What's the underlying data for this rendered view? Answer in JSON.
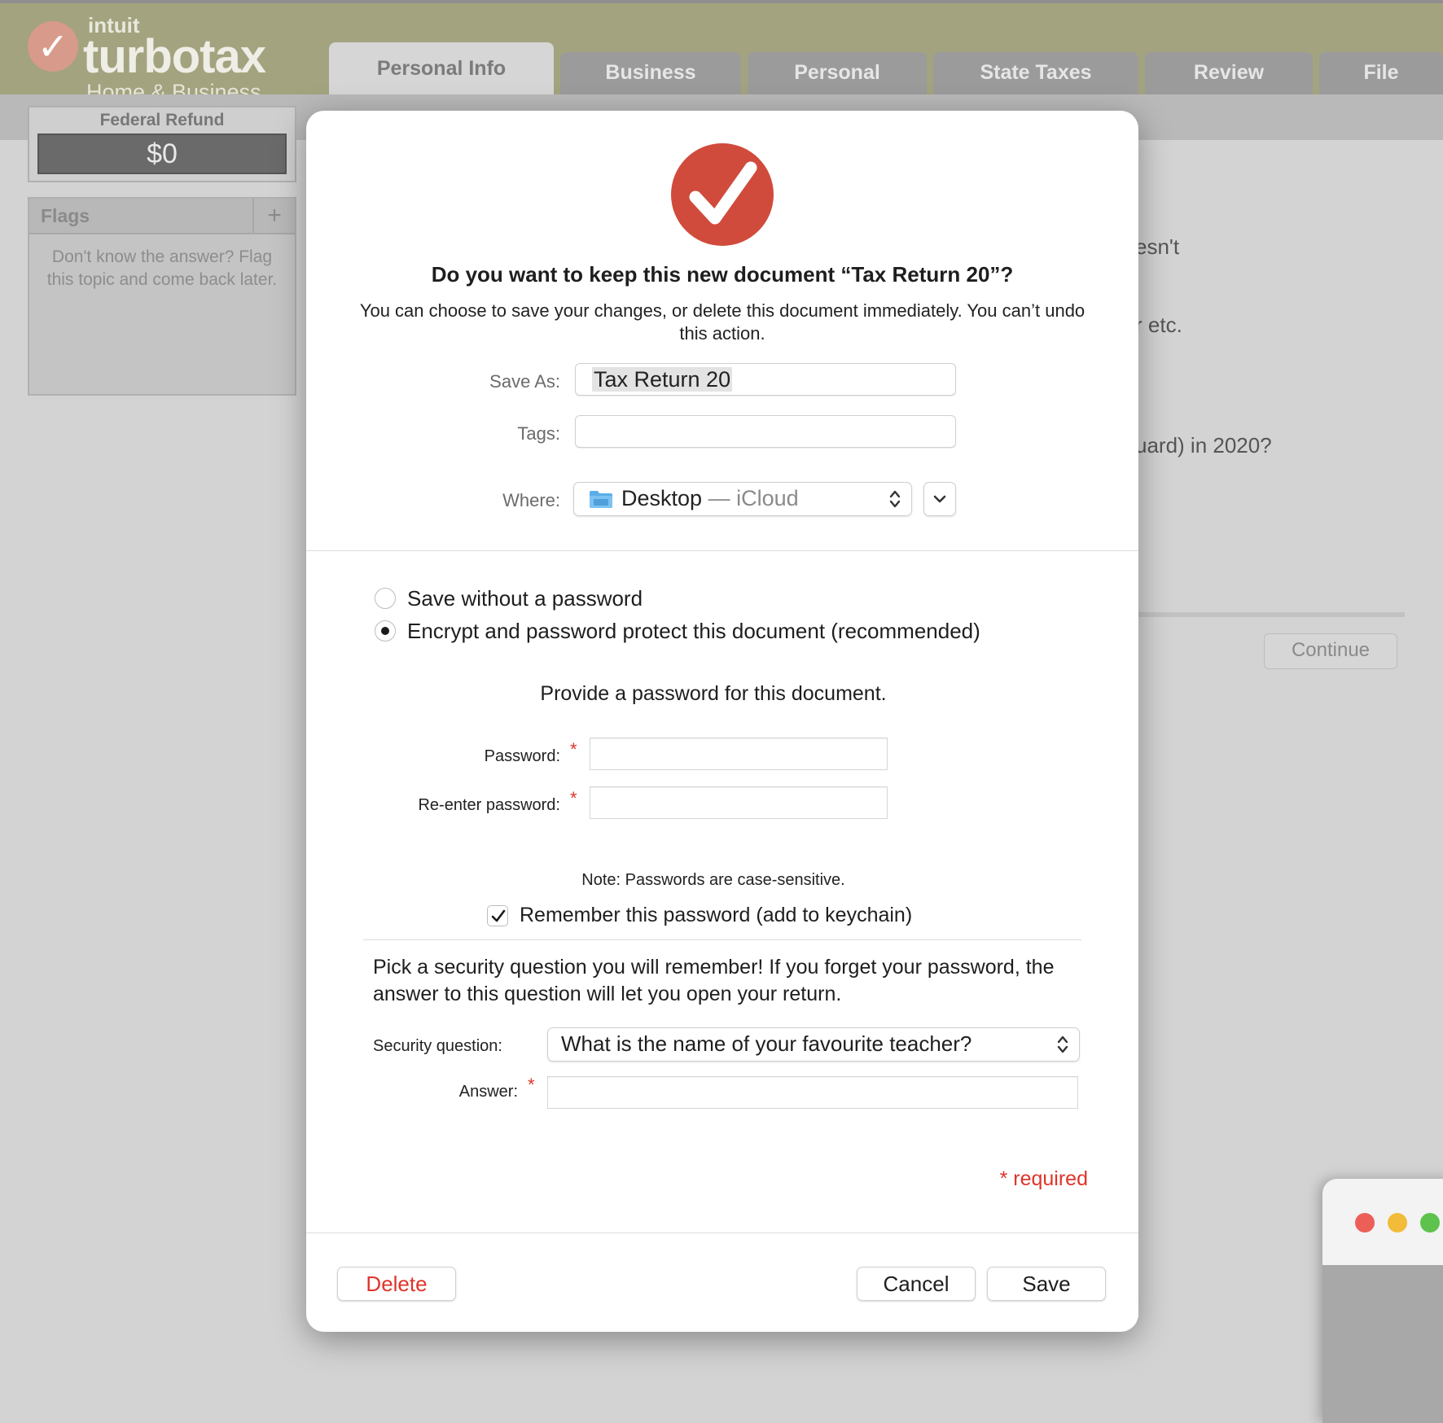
{
  "app": {
    "logo": {
      "company": "intuit",
      "product": "turbotax",
      "edition": "Home & Business"
    },
    "tabs": [
      {
        "label": "Personal Info",
        "active": true
      },
      {
        "label": "Business"
      },
      {
        "label": "Personal"
      },
      {
        "label": "State Taxes"
      },
      {
        "label": "Review"
      },
      {
        "label": "File"
      }
    ],
    "refund": {
      "label": "Federal Refund",
      "amount": "$0"
    },
    "flags": {
      "title": "Flags",
      "add_symbol": "+",
      "help_text": "Don't know the answer? Flag this topic and come back later."
    },
    "background_fragments": [
      "esn't",
      "r etc.",
      "uard) in 2020?"
    ],
    "continue_label": "Continue"
  },
  "dialog": {
    "title": "Do you want to keep this new document “Tax Return 20”?",
    "description": "You can choose to save your changes, or delete this document immediately. You can’t undo this action.",
    "save_as": {
      "label": "Save As:",
      "value": "Tax Return 20"
    },
    "tags": {
      "label": "Tags:",
      "value": ""
    },
    "where": {
      "label": "Where:",
      "location": "Desktop",
      "separator": " — ",
      "service": "iCloud"
    },
    "options": [
      {
        "label": "Save without a password",
        "selected": false
      },
      {
        "label": "Encrypt and password protect this document (recommended)",
        "selected": true
      }
    ],
    "password_prompt": "Provide a password for this document.",
    "password_label": "Password:",
    "reenter_label": "Re-enter password:",
    "required_marker": "*",
    "note": "Note: Passwords are case-sensitive.",
    "remember": {
      "label": "Remember this password (add to keychain)",
      "checked": true
    },
    "security_intro": "Pick a security question you will remember! If you forget your password, the answer to this question will let you open your return.",
    "security_question": {
      "label": "Security question:",
      "value": "What is the name of your favourite teacher?"
    },
    "answer_label": "Answer:",
    "required_note": "* required",
    "buttons": {
      "delete": "Delete",
      "cancel": "Cancel",
      "save": "Save"
    }
  },
  "colors": {
    "brand_red": "#d04b3c",
    "required_red": "#e0342a",
    "header_olive": "#a3a37f"
  }
}
